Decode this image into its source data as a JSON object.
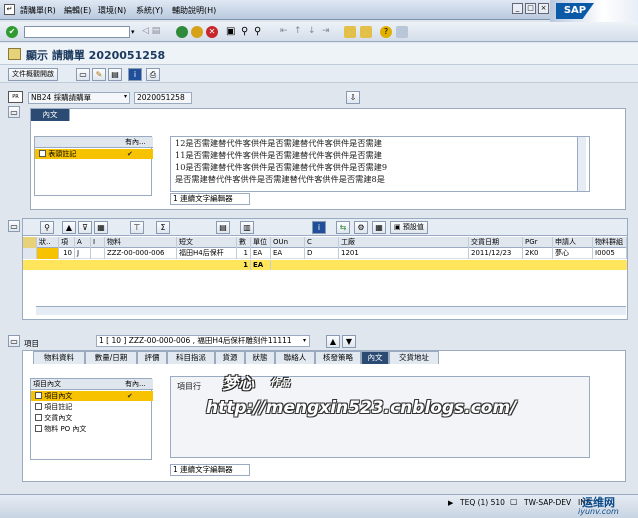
{
  "menu": {
    "items": [
      "請購單(R)",
      "編輯(E)",
      "環境(N)",
      "系統(Y)",
      "輔助說明(H)"
    ]
  },
  "brand": {
    "logo": "SAP"
  },
  "window": {
    "minimize": "_",
    "restore": "□",
    "close": "×"
  },
  "title": "顯示 請購單 2020051258",
  "appbar": {
    "overview_label": "文件概觀開啟"
  },
  "header": {
    "doc_type": "NB24 採購請購單",
    "doc_number": "2020051258"
  },
  "header_text_tab": "內文",
  "header_text_list": {
    "col1": "",
    "col2": "有內...",
    "items": [
      {
        "label": "表頭註記",
        "has_text": true
      }
    ]
  },
  "header_text_lines": [
    "12是否需建替代件客供件是否需建替代件客供件是否需建",
    "11是否需建替代件客供件是否需建替代件客供件是否需建",
    "10是否需建替代件客供件是否需建替代件客供件是否需建9",
    "是否需建替代件客供件是否需建替代件客供件是否需建8是"
  ],
  "header_editor_label": "1 連續文字編輯器",
  "items_toolbar": {
    "default_label": "預設值"
  },
  "item_table": {
    "columns": [
      "狀..",
      "項",
      "A",
      "I",
      "物料",
      "短文",
      "數",
      "單位",
      "OUn",
      "C",
      "工廠",
      "交貨日期",
      "PGr",
      "申請人",
      "物料群組"
    ],
    "rows": [
      [
        "",
        "10",
        "J",
        "",
        "ZZZ-00-000-006",
        "福田H4后保杆",
        "1",
        "EA",
        "EA",
        "D",
        "1201",
        "2011/12/23",
        "2K0",
        "夢心",
        "I0005"
      ]
    ],
    "total_qty": "1",
    "total_unit": "EA"
  },
  "item_selector": {
    "label": "項目",
    "value": "1 [ 10 ] ZZZ-00-000-006 , 福田H4后保杆雕刻件11111"
  },
  "detail_tabs": [
    "物料資料",
    "數量/日期",
    "評價",
    "科目指派",
    "貨源",
    "狀態",
    "聯絡人",
    "核發策略",
    "內文",
    "交貨地址"
  ],
  "detail_active_tab": "內文",
  "item_text_list": {
    "col1": "項目內文",
    "col2": "有內...",
    "items": [
      {
        "label": "項目內文",
        "has_text": true
      },
      {
        "label": "項目註記",
        "has_text": false
      },
      {
        "label": "交貨內文",
        "has_text": false
      },
      {
        "label": "物料 PO 內文",
        "has_text": false
      }
    ]
  },
  "item_text_content": "項目行",
  "item_editor_label": "1 連續文字編輯器",
  "watermark": {
    "title": "梦心",
    "suffix": "作品",
    "url": "http://mengxin523.cnblogs.com/"
  },
  "statusbar": {
    "session": "TEQ (1) 510",
    "server": "TW-SAP-DEV",
    "mode": "INS"
  },
  "corner_watermark": {
    "cn": "运维网",
    "site": "iyunv.com"
  }
}
